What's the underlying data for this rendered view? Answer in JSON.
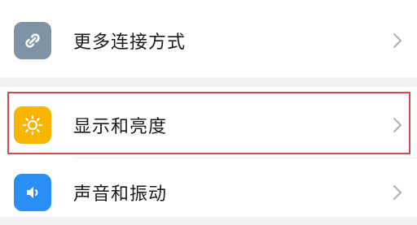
{
  "settings": {
    "items": [
      {
        "label": "更多连接方式",
        "icon": "link-icon",
        "icon_color": "#7f93a6"
      },
      {
        "label": "显示和亮度",
        "icon": "brightness-sun-icon",
        "icon_color": "#f7b500"
      },
      {
        "label": "声音和振动",
        "icon": "speaker-icon",
        "icon_color": "#2a8ef7"
      }
    ]
  },
  "highlight_color": "#d34a4a"
}
